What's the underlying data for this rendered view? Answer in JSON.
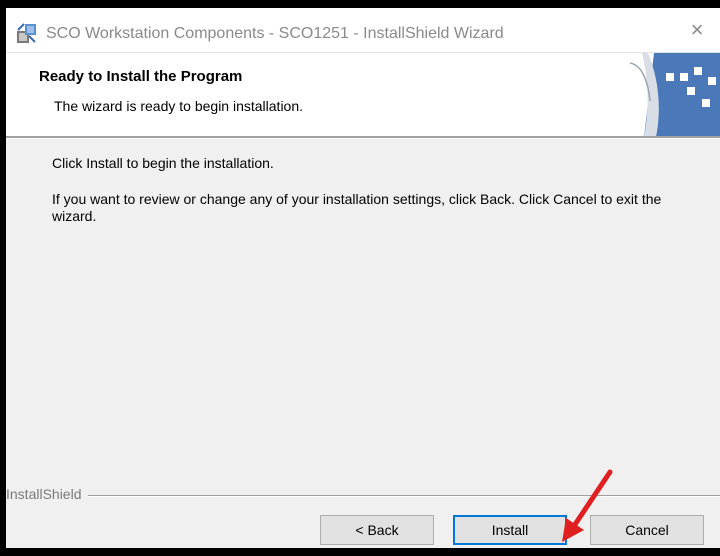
{
  "window": {
    "title": "SCO Workstation Components - SCO1251 - InstallShield Wizard",
    "close_icon": "×"
  },
  "header": {
    "title": "Ready to Install the Program",
    "description": "The wizard is ready to begin installation."
  },
  "body": {
    "line1": "Click Install to begin the installation.",
    "line2": "If you want to review or change any of your installation settings, click Back. Click Cancel to exit the wizard."
  },
  "footer": {
    "brand": "InstallShield"
  },
  "buttons": {
    "back": "< Back",
    "install": "Install",
    "cancel": "Cancel"
  },
  "colors": {
    "focus_border": "#0078d7",
    "annotation_arrow": "#e02020",
    "graphic_blue": "#4a78b8"
  }
}
